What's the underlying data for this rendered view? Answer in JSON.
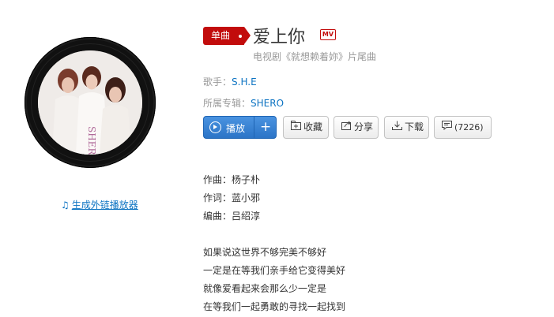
{
  "badge": {
    "label": "单曲"
  },
  "song": {
    "title": "爱上你",
    "mv_label": "MV",
    "subtitle": "电视剧《就想赖着妳》片尾曲"
  },
  "artist": {
    "label": "歌手：",
    "name": "S.H.E"
  },
  "album": {
    "label": "所属专辑：",
    "name": "SHERO"
  },
  "actions": {
    "play_label": "播放",
    "add_symbol": "+",
    "collect_label": "收藏",
    "share_label": "分享",
    "download_label": "下载",
    "comment_count": "(7226)"
  },
  "icons": {
    "play": "play-circle-icon",
    "add": "plus-icon",
    "collect": "folder-plus-icon",
    "share": "share-icon",
    "download": "download-icon",
    "comment": "comment-icon",
    "external": "music-note-icon"
  },
  "external_player_link": "生成外链播放器",
  "credits": [
    "作曲：杨子朴",
    "作词：蓝小邪",
    "编曲：吕绍淳"
  ],
  "lyrics": [
    "如果说这世界不够完美不够好",
    "一定是在等我们亲手给它变得美好",
    "就像爱看起来会那么少一定是",
    "在等我们一起勇敢的寻找一起找到"
  ],
  "cover_text": "SHERO",
  "colors": {
    "accent_red": "#c20c0c",
    "link_blue": "#0c73c2",
    "play_blue": "#2b74c7",
    "muted_gray": "#999999"
  }
}
